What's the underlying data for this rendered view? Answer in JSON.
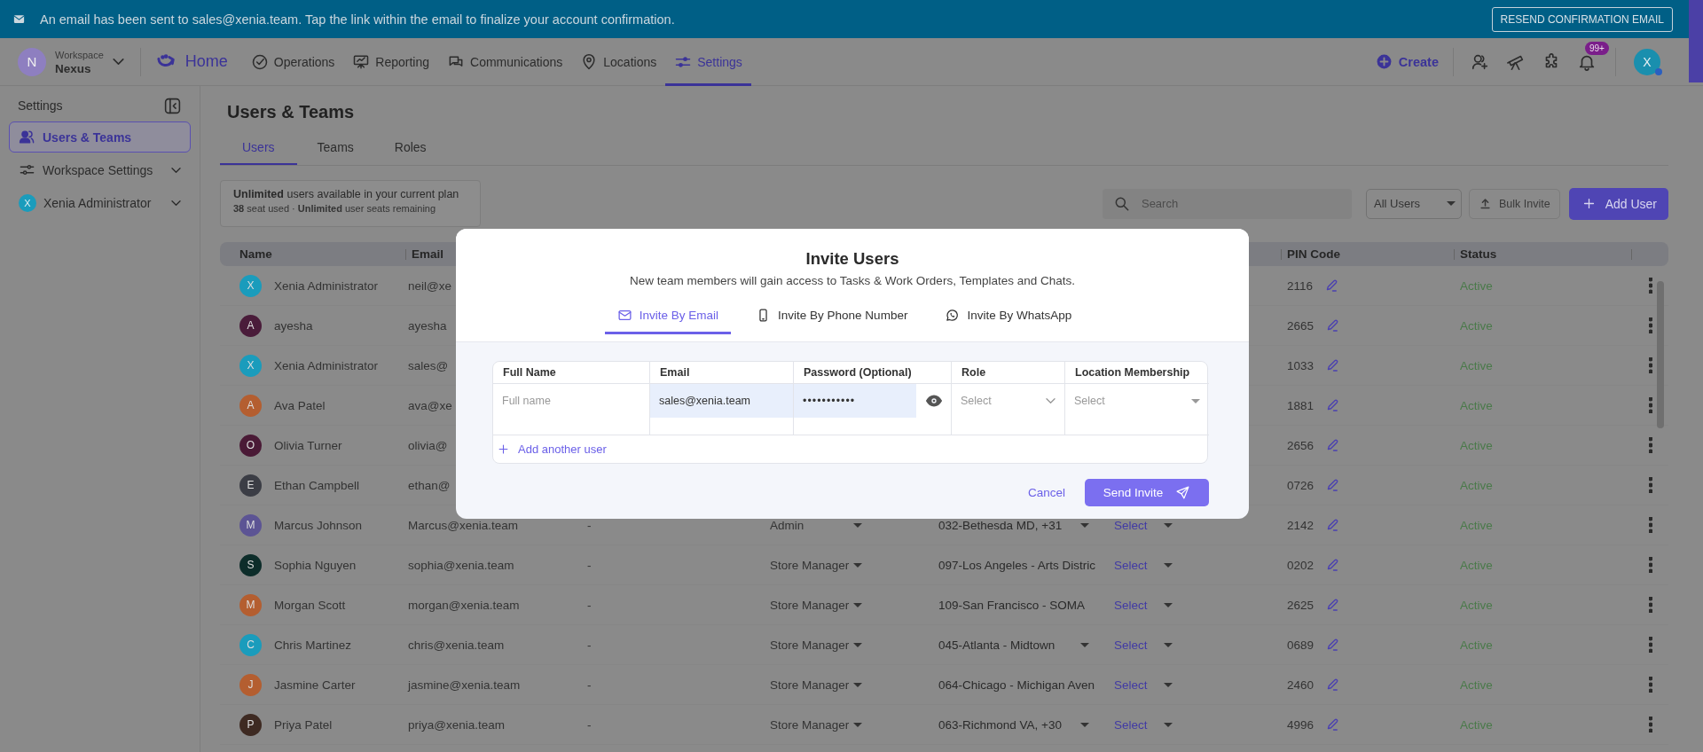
{
  "banner": {
    "message": "An email has been sent to sales@xenia.team. Tap the link within the email to finalize your account confirmation.",
    "button": "RESEND CONFIRMATION EMAIL"
  },
  "nav": {
    "workspace": {
      "caption": "Workspace",
      "name": "Nexus",
      "initial": "N"
    },
    "home": "Home",
    "items": [
      {
        "label": "Operations",
        "selected": false
      },
      {
        "label": "Reporting",
        "selected": false
      },
      {
        "label": "Communications",
        "selected": false
      },
      {
        "label": "Locations",
        "selected": false
      },
      {
        "label": "Settings",
        "selected": true
      }
    ],
    "create": "Create",
    "notification_badge": "99+",
    "avatar_initial": "X"
  },
  "sidebar": {
    "title": "Settings",
    "items": [
      {
        "label": "Users & Teams",
        "selected": true,
        "expandable": false
      },
      {
        "label": "Workspace Settings",
        "selected": false,
        "expandable": true
      },
      {
        "label": "Xenia Administrator",
        "initial": "X",
        "selected": false,
        "expandable": true
      }
    ]
  },
  "page": {
    "title": "Users & Teams",
    "tabs": [
      {
        "label": "Users",
        "selected": true
      },
      {
        "label": "Teams",
        "selected": false
      },
      {
        "label": "Roles",
        "selected": false
      }
    ],
    "plan": {
      "headline": "**Unlimited** users available in your current plan",
      "detail": "**38** seat used · **Unlimited** user seats remaining"
    },
    "search": {
      "placeholder": "Search"
    },
    "filter": "All Users",
    "bulk_invite": "Bulk Invite",
    "add_user": "Add User"
  },
  "table": {
    "headings": {
      "name": "Name",
      "email": "Email",
      "pin_code": "PIN Code",
      "status": "Status"
    },
    "rows": [
      {
        "initial": "X",
        "color": "#1a9cbc",
        "name": "Xenia Administrator",
        "email": "neil@xe",
        "pin_code": "2116",
        "status": "Active"
      },
      {
        "initial": "A",
        "color": "#4a1c3a",
        "name": "ayesha",
        "email": "ayesha",
        "pin_code": "2665",
        "status": "Active"
      },
      {
        "initial": "X",
        "color": "#1a9cbc",
        "name": "Xenia Administrator",
        "email": "sales@",
        "pin_code": "1033",
        "status": "Active"
      },
      {
        "initial": "A",
        "color": "#b45e30",
        "name": "Ava Patel",
        "email": "ava@xe",
        "pin_code": "1881",
        "status": "Active"
      },
      {
        "initial": "O",
        "color": "#4a1a36",
        "name": "Olivia Turner",
        "email": "olivia@",
        "pin_code": "2656",
        "status": "Active"
      },
      {
        "initial": "E",
        "color": "#3b3d45",
        "name": "Ethan Campbell",
        "email": "ethan@",
        "pin_code": "0726",
        "status": "Active"
      },
      {
        "initial": "M",
        "color": "#5c5494",
        "name": "Marcus Johnson",
        "email": "Marcus@xenia.team",
        "column_3": "-",
        "column_4": "Admin",
        "column_5": {
          "text": "032-Bethesda MD, +31",
          "caret": true
        },
        "column_6": "Select",
        "pin_code": "2142",
        "status": "Active"
      },
      {
        "initial": "S",
        "color": "#0d2d2a",
        "name": "Sophia Nguyen",
        "email": "sophia@xenia.team",
        "column_3": "-",
        "column_4": "Store Manager",
        "column_5": {
          "text": "097-Los Angeles - Arts Distric",
          "caret": false
        },
        "column_6": "Select",
        "pin_code": "0202",
        "status": "Active"
      },
      {
        "initial": "M",
        "color": "#b45e30",
        "name": "Morgan Scott",
        "email": "morgan@xenia.team",
        "column_3": "-",
        "column_4": "Store Manager",
        "column_5": {
          "text": "109-San Francisco - SOMA",
          "caret": false
        },
        "column_6": "Select",
        "pin_code": "2625",
        "status": "Active"
      },
      {
        "initial": "C",
        "color": "#1a9cbc",
        "name": "Chris Martinez",
        "email": "chris@xenia.team",
        "column_3": "-",
        "column_4": "Store Manager",
        "column_5": {
          "text": "045-Atlanta - Midtown",
          "caret": true
        },
        "column_6": "Select",
        "pin_code": "0689",
        "status": "Active"
      },
      {
        "initial": "J",
        "color": "#b45e30",
        "name": "Jasmine Carter",
        "email": "jasmine@xenia.team",
        "column_3": "-",
        "column_4": "Store Manager",
        "column_5": {
          "text": "064-Chicago - Michigan Aven",
          "caret": false
        },
        "column_6": "Select",
        "pin_code": "2460",
        "status": "Active"
      },
      {
        "initial": "P",
        "color": "#3e2a22",
        "name": "Priya Patel",
        "email": "priya@xenia.team",
        "column_3": "-",
        "column_4": "Store Manager",
        "column_5": {
          "text": "063-Richmond VA, +30",
          "caret": true
        },
        "column_6": "Select",
        "pin_code": "4996",
        "status": "Active"
      }
    ]
  },
  "modal": {
    "title": "Invite Users",
    "subtitle": "New team members will gain access to Tasks & Work Orders, Templates and Chats.",
    "tabs": [
      {
        "label": "Invite By Email",
        "selected": true
      },
      {
        "label": "Invite By Phone Number",
        "selected": false
      },
      {
        "label": "Invite By WhatsApp",
        "selected": false
      }
    ],
    "form": {
      "columns": [
        "Full Name",
        "Email",
        "Password (Optional)",
        "Role",
        "Location Membership"
      ],
      "row": {
        "full_name": {
          "placeholder": "Full name"
        },
        "email": {
          "value": "sales@xenia.team"
        },
        "password": {
          "value": "•••••••••••"
        },
        "role": {
          "placeholder": "Select"
        },
        "location": {
          "placeholder": "Select"
        }
      },
      "add_another": "Add another user"
    },
    "cancel": "Cancel",
    "send": "Send Invite"
  }
}
